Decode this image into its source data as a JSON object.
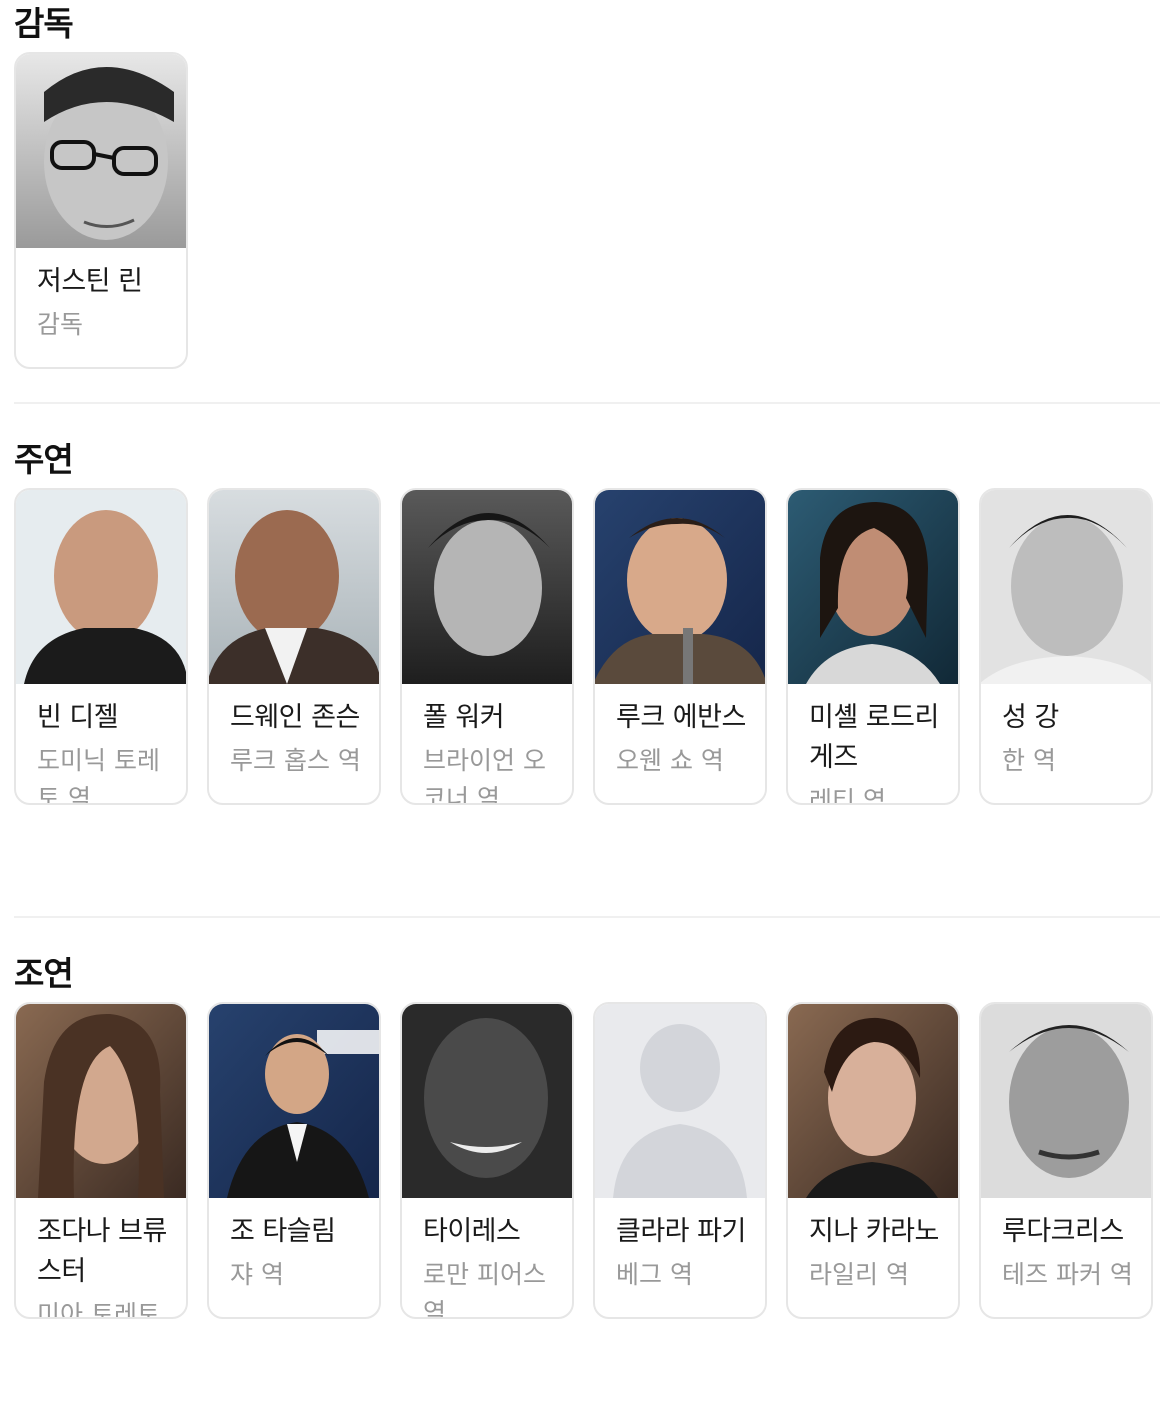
{
  "sections": [
    {
      "title": "감독",
      "people": [
        {
          "name": "저스틴 린",
          "role": "감독"
        }
      ]
    },
    {
      "title": "주연",
      "people": [
        {
          "name": "빈 디젤",
          "role": "도미닉 토레토 역"
        },
        {
          "name": "드웨인 존슨",
          "role": "루크 홉스 역"
        },
        {
          "name": "폴 워커",
          "role": "브라이언 오코너 역"
        },
        {
          "name": "루크 에반스",
          "role": "오웬 쇼 역"
        },
        {
          "name": "미셸 로드리게즈",
          "role": "레티 역"
        },
        {
          "name": "성 강",
          "role": "한 역"
        }
      ]
    },
    {
      "title": "조연",
      "people": [
        {
          "name": "조다나 브류스터",
          "role": "미아 토레토 역"
        },
        {
          "name": "조 타슬림",
          "role": "쟈 역"
        },
        {
          "name": "타이레스",
          "role": "로만 피어스 역"
        },
        {
          "name": "클라라 파기",
          "role": "베그 역"
        },
        {
          "name": "지나 카라노",
          "role": "라일리 역"
        },
        {
          "name": "루다크리스",
          "role": "테즈 파커 역"
        }
      ]
    }
  ]
}
